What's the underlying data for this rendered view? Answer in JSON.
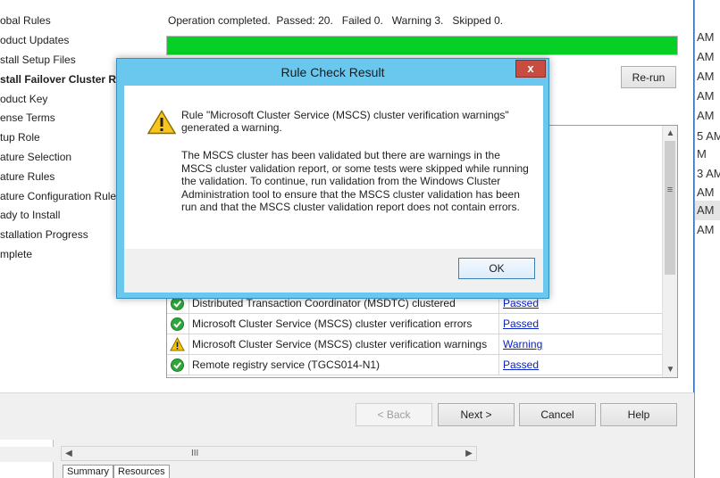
{
  "setup": {
    "nav_steps": [
      "obal Rules",
      "oduct Updates",
      "stall Setup Files",
      "stall Failover Cluster Rule",
      "oduct Key",
      "ense Terms",
      "tup Role",
      "ature Selection",
      "ature Rules",
      "ature Configuration Rules",
      "ady to Install",
      "stallation Progress",
      "mplete"
    ],
    "current_step_index": 3,
    "status_text": "Operation completed.  Passed: 20.   Failed 0.   Warning 3.   Skipped 0.",
    "progress_percent": 100,
    "progress_color": "#06d025",
    "rerun_label": "Re-run",
    "rules": [
      {
        "icon": "check-icon",
        "rule": "Distributed Transaction Coordinator (MSDTC) clustered",
        "status": "Passed"
      },
      {
        "icon": "check-icon",
        "rule": "Microsoft Cluster Service (MSCS) cluster verification errors",
        "status": "Passed"
      },
      {
        "icon": "warning-icon",
        "rule": "Microsoft Cluster Service (MSCS) cluster verification warnings",
        "status": "Warning"
      },
      {
        "icon": "check-icon",
        "rule": "Remote registry service (TGCS014-N1)",
        "status": "Passed"
      }
    ],
    "buttons": {
      "back": "< Back",
      "next": "Next >",
      "cancel": "Cancel",
      "help": "Help"
    }
  },
  "background": {
    "times": [
      "AM",
      "AM",
      "AM",
      "AM",
      "AM",
      "5 AM",
      "M",
      "3 AM",
      "AM",
      "AM",
      "AM"
    ],
    "selected_time_index": 8,
    "tabs": [
      "Summary",
      "Resources"
    ]
  },
  "dialog": {
    "title": "Rule Check Result",
    "close_label": "x",
    "message_title": "Rule \"Microsoft Cluster Service (MSCS) cluster verification warnings\" generated a warning.",
    "message_body": "The MSCS cluster has been validated but there are warnings in the MSCS cluster validation report, or some tests were skipped while running the validation. To continue, run validation from the Windows Cluster Administration tool to ensure that the MSCS cluster validation has been run and that the MSCS cluster validation report does not contain errors.",
    "ok_label": "OK",
    "accent": "#6ac8ee",
    "close_color": "#c94c41"
  }
}
